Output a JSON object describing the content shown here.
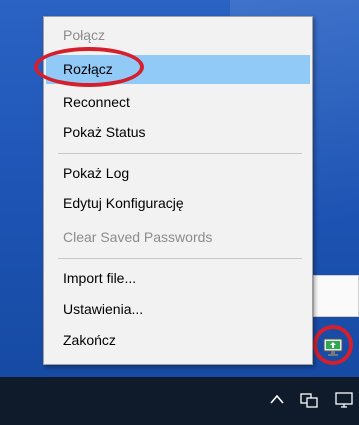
{
  "menu": {
    "items": [
      {
        "label": "Połącz",
        "disabled": true
      },
      {
        "label": "Rozłącz",
        "selected": true
      },
      {
        "label": "Reconnect"
      },
      {
        "label": "Pokaż Status"
      },
      {
        "label": "Pokaż Log"
      },
      {
        "label": "Edytuj Konfigurację"
      },
      {
        "label": "Clear Saved Passwords",
        "disabled": true
      },
      {
        "label": "Import file..."
      },
      {
        "label": "Ustawienia..."
      },
      {
        "label": "Zakończ"
      }
    ]
  },
  "tray": {
    "chevron_glyph": "^",
    "icons": [
      "openvpn-tray-icon",
      "network-icon",
      "display-icon"
    ]
  },
  "colors": {
    "highlight": "#91c9f7",
    "annotation_red": "#d61f2c",
    "taskbar": "#0f1a2b",
    "desktop": "#1f58b8"
  }
}
